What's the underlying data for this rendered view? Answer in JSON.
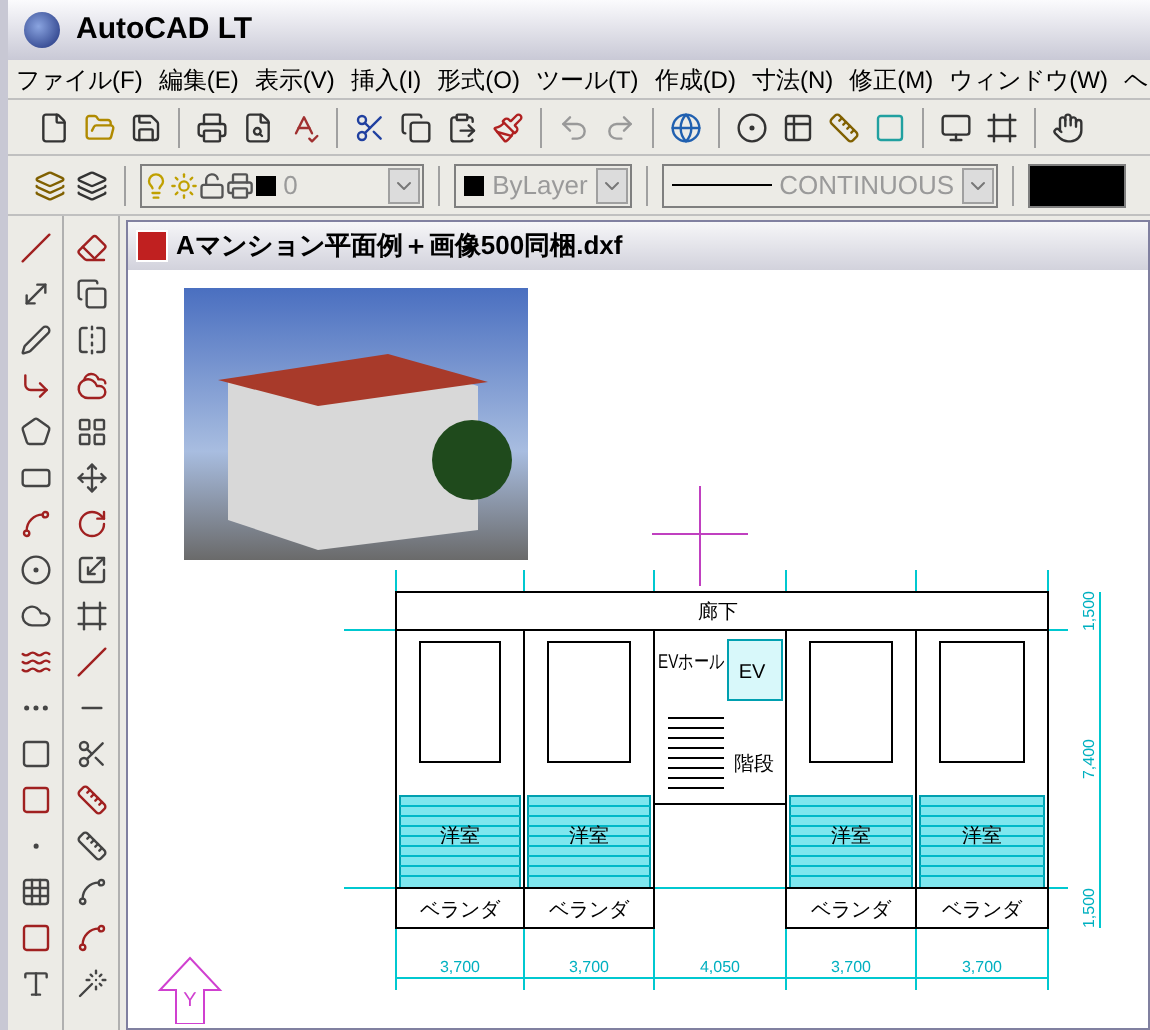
{
  "window": {
    "title": "AutoCAD LT"
  },
  "menu": [
    "ファイル(F)",
    "編集(E)",
    "表示(V)",
    "挿入(I)",
    "形式(O)",
    "ツール(T)",
    "作成(D)",
    "寸法(N)",
    "修正(M)",
    "ウィンドウ(W)",
    "ヘ"
  ],
  "properties_bar": {
    "layer": {
      "value": "0",
      "disabled": true
    },
    "color": {
      "value": "ByLayer",
      "disabled": true
    },
    "linetype": {
      "value": "CONTINUOUS",
      "disabled": true
    }
  },
  "document": {
    "title": "Aマンション平面例＋画像500同梱.dxf"
  },
  "drawing": {
    "corridor": "廊下",
    "ev_hall": "EVホール",
    "elevator": "EV",
    "stairs": "階段",
    "units": [
      {
        "room": "洋室",
        "balcony": "ベランダ"
      },
      {
        "room": "洋室",
        "balcony": "ベランダ"
      },
      {
        "room": "洋室",
        "balcony": "ベランダ"
      },
      {
        "room": "洋室",
        "balcony": "ベランダ"
      }
    ],
    "width_dims": [
      "3,700",
      "3,700",
      "4,050",
      "3,700",
      "3,700"
    ],
    "height_dims": [
      "1,500",
      "7,400",
      "1,500"
    ],
    "ucs_label": "Y"
  }
}
